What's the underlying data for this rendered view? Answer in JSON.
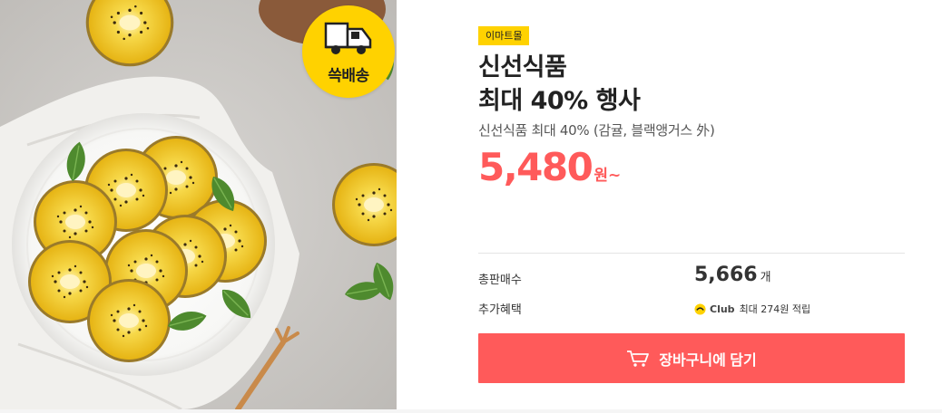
{
  "product": {
    "image_alt": "골드키위",
    "delivery_badge": "쓱배송",
    "mall_badge": "이마트몰",
    "title_lines": [
      "신선식품",
      "최대 40% 행사"
    ],
    "subtitle": "신선식품 최대 40% (감귤, 블랙앵거스 外)",
    "price": "5,480",
    "price_unit": "원~"
  },
  "info": {
    "sold_label": "총판매수",
    "sold_count": "5,666",
    "sold_unit": "개",
    "benefit_label": "추가혜택",
    "club_name": "Club",
    "club_benefit": "최대 274원 적립"
  },
  "actions": {
    "add_to_cart": "장바구니에 담기"
  },
  "colors": {
    "accent": "#ff5a5a",
    "badge_yellow": "#ffd200",
    "kiwi_flesh": "#f0c419"
  }
}
